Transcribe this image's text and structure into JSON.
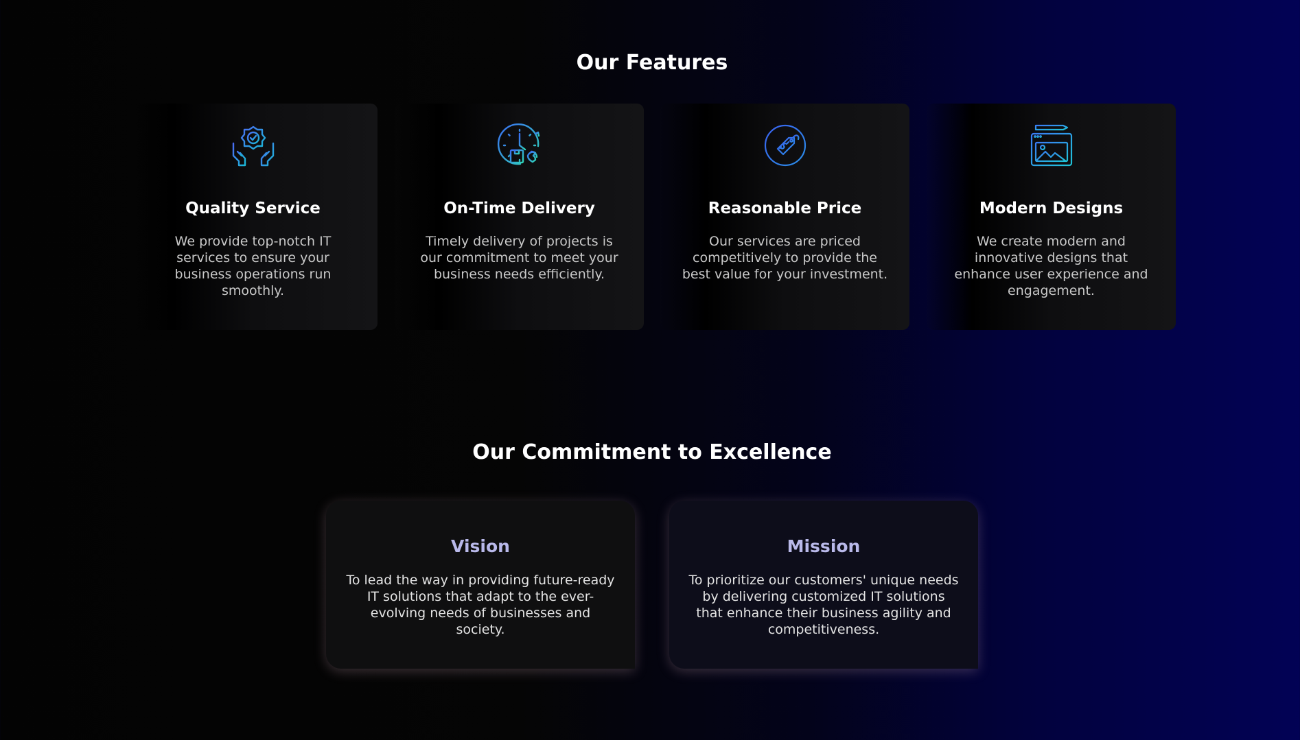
{
  "features": {
    "title": "Our Features",
    "items": [
      {
        "icon": "hands-shield-check-icon",
        "title": "Quality Service",
        "description": "We provide top-notch IT services to ensure your business operations run smoothly."
      },
      {
        "icon": "clock-delivery-icon",
        "title": "On-Time Delivery",
        "description": "Timely delivery of projects is our commitment to meet your business needs efficiently."
      },
      {
        "icon": "price-tag-icon",
        "title": "Reasonable Price",
        "description": "Our services are priced competitively to provide the best value for your investment."
      },
      {
        "icon": "design-window-icon",
        "title": "Modern Designs",
        "description": "We create modern and innovative designs that enhance user experience and engagement."
      }
    ]
  },
  "commitment": {
    "title": "Our Commitment to Excellence",
    "vision": {
      "title": "Vision",
      "description": "To lead the way in providing future-ready IT solutions that adapt to the ever-evolving needs of businesses and society."
    },
    "mission": {
      "title": "Mission",
      "description": "To prioritize our customers' unique needs by delivering customized IT solutions that enhance their business agility and competitiveness."
    }
  },
  "colors": {
    "icon_gradient_start": "#3b7bf5",
    "icon_gradient_end": "#19c7c9",
    "commit_title": "#b9b9ea",
    "background_right": "#020255"
  }
}
